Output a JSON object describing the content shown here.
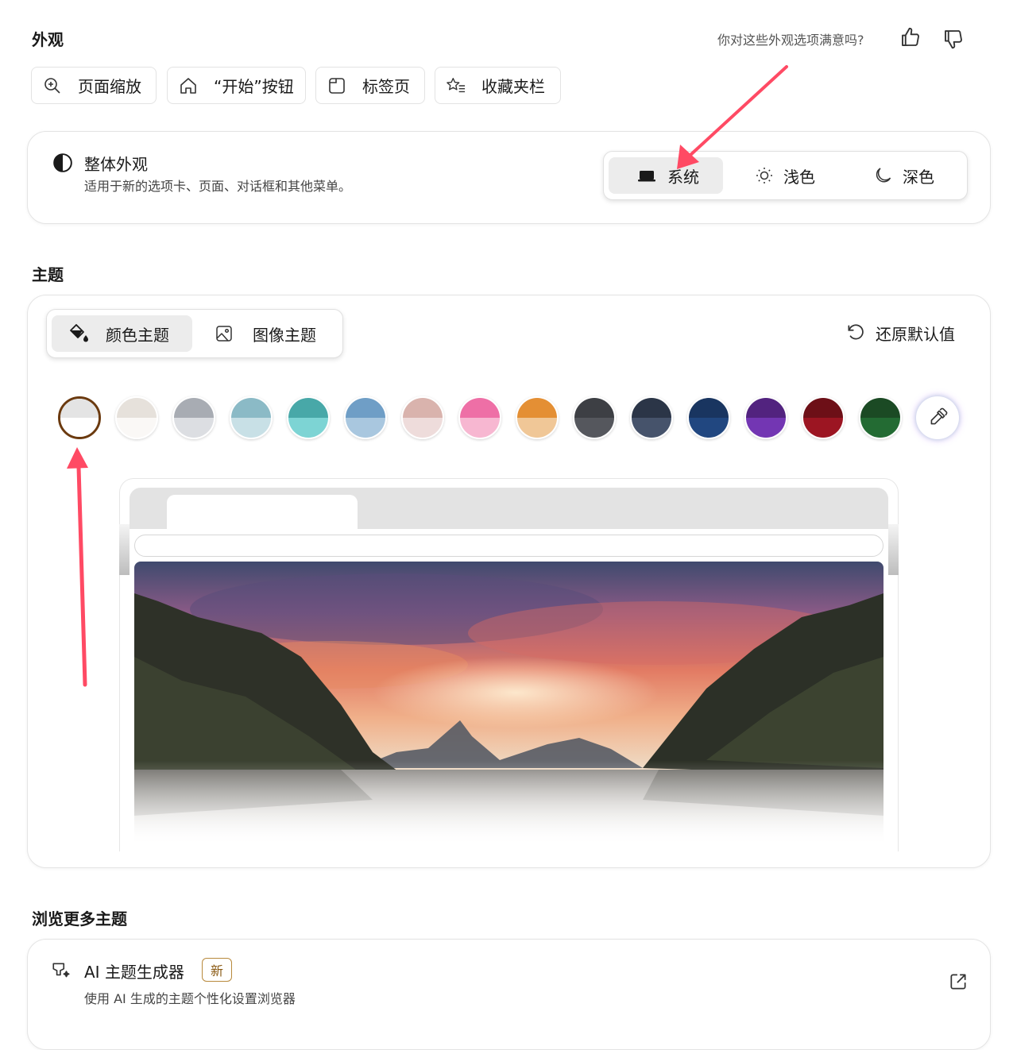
{
  "appearance": {
    "title": "外观",
    "feedback_question": "你对这些外观选项满意吗?",
    "thumbs_up_icon": "thumbs-up-icon",
    "thumbs_down_icon": "thumbs-down-icon",
    "quick_links": [
      {
        "label": "页面缩放",
        "icon": "zoom-icon"
      },
      {
        "label": "“开始”按钮",
        "icon": "home-icon"
      },
      {
        "label": "标签页",
        "icon": "tab-icon"
      },
      {
        "label": "收藏夹栏",
        "icon": "favorites-bar-icon"
      }
    ],
    "overall": {
      "title": "整体外观",
      "description": "适用于新的选项卡、页面、对话框和其他菜单。",
      "options": [
        {
          "label": "系统",
          "icon": "laptop-icon",
          "selected": true
        },
        {
          "label": "浅色",
          "icon": "sun-icon",
          "selected": false
        },
        {
          "label": "深色",
          "icon": "moon-icon",
          "selected": false
        }
      ]
    }
  },
  "theme": {
    "title": "主题",
    "tabs": [
      {
        "label": "颜色主题",
        "icon": "paint-bucket-icon",
        "selected": true
      },
      {
        "label": "图像主题",
        "icon": "image-icon",
        "selected": false
      }
    ],
    "reset_label": "还原默认值",
    "swatches": [
      {
        "top": "#e4e4e4",
        "bottom": "#ffffff",
        "selected": true
      },
      {
        "top": "#e6e1db",
        "bottom": "#faf8f6"
      },
      {
        "top": "#a8acb3",
        "bottom": "#dcdee2"
      },
      {
        "top": "#8bbac6",
        "bottom": "#c8e0e6"
      },
      {
        "top": "#48a8a8",
        "bottom": "#7dd4d4"
      },
      {
        "top": "#6f9ec6",
        "bottom": "#a9c7df"
      },
      {
        "top": "#d9b3ad",
        "bottom": "#eedcdb"
      },
      {
        "top": "#ee6fa6",
        "bottom": "#f7b7d1"
      },
      {
        "top": "#e48f34",
        "bottom": "#f0c797"
      },
      {
        "top": "#3d3f44",
        "bottom": "#55575d"
      },
      {
        "top": "#2b3547",
        "bottom": "#46536b"
      },
      {
        "top": "#193560",
        "bottom": "#214780"
      },
      {
        "top": "#52237f",
        "bottom": "#7336b3"
      },
      {
        "top": "#6d0f17",
        "bottom": "#9c1522"
      },
      {
        "top": "#1b4a24",
        "bottom": "#236b33"
      }
    ],
    "custom_color_icon": "eyedropper-icon"
  },
  "more_themes": {
    "title": "浏览更多主题",
    "ai_generator": {
      "title": "AI 主题生成器",
      "badge": "新",
      "description": "使用 AI 生成的主题个性化设置浏览器",
      "icon": "ai-theme-icon",
      "open_icon": "external-link-icon"
    }
  }
}
